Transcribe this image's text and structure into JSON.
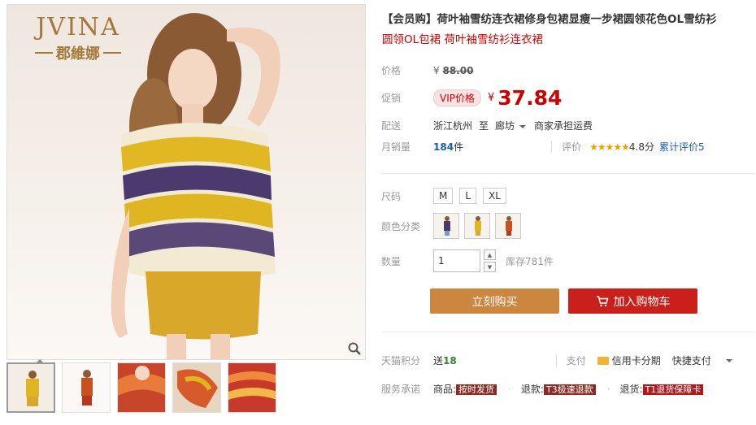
{
  "brand": {
    "logo_en": "JVINA",
    "logo_cn": "郡維娜"
  },
  "product": {
    "title": "【会员购】荷叶袖雪纺连衣裙修身包裙显瘦一步裙圆领花色OL雪纺衫",
    "subtitle": "圆领OL包裙 荷叶袖雪纺衫连衣裙"
  },
  "price": {
    "label": "价格",
    "currency": "¥",
    "original": "88.00"
  },
  "promo": {
    "label": "促销",
    "badge": "VIP价格",
    "currency": "¥",
    "price": "37.84"
  },
  "shipping": {
    "label": "配送",
    "from": "浙江杭州",
    "to_word": "至",
    "dest": "廊坊",
    "note": "商家承担运费"
  },
  "sales": {
    "label": "月销量",
    "count": "184",
    "unit": "件",
    "rating_label": "评价",
    "stars": "★★★★★",
    "score": "4.8分",
    "review_link": "累计评价5"
  },
  "size": {
    "label": "尺码",
    "options": [
      "M",
      "L",
      "XL"
    ]
  },
  "color": {
    "label": "颜色分类"
  },
  "quantity": {
    "label": "数量",
    "value": "1",
    "stock": "库存781件"
  },
  "buttons": {
    "buy_now": "立刻购买",
    "add_cart": "加入购物车"
  },
  "points": {
    "label": "天猫积分",
    "prefix": "送",
    "value": "18",
    "pay_label": "支付",
    "credit": "信用卡分期",
    "quick": "快捷支付"
  },
  "services": {
    "label": "服务承诺",
    "goods_label": "商品:",
    "goods_tag": "按时发货",
    "refund_label": "退款:",
    "refund_tag": "T3极速退款",
    "return_label": "退货:",
    "return_tag": "T1退货保障卡"
  },
  "colors": {
    "price_red": "#c00000",
    "buy_button": "#cb863f",
    "cart_button": "#c9201b",
    "link_blue": "#1a5fa5"
  }
}
